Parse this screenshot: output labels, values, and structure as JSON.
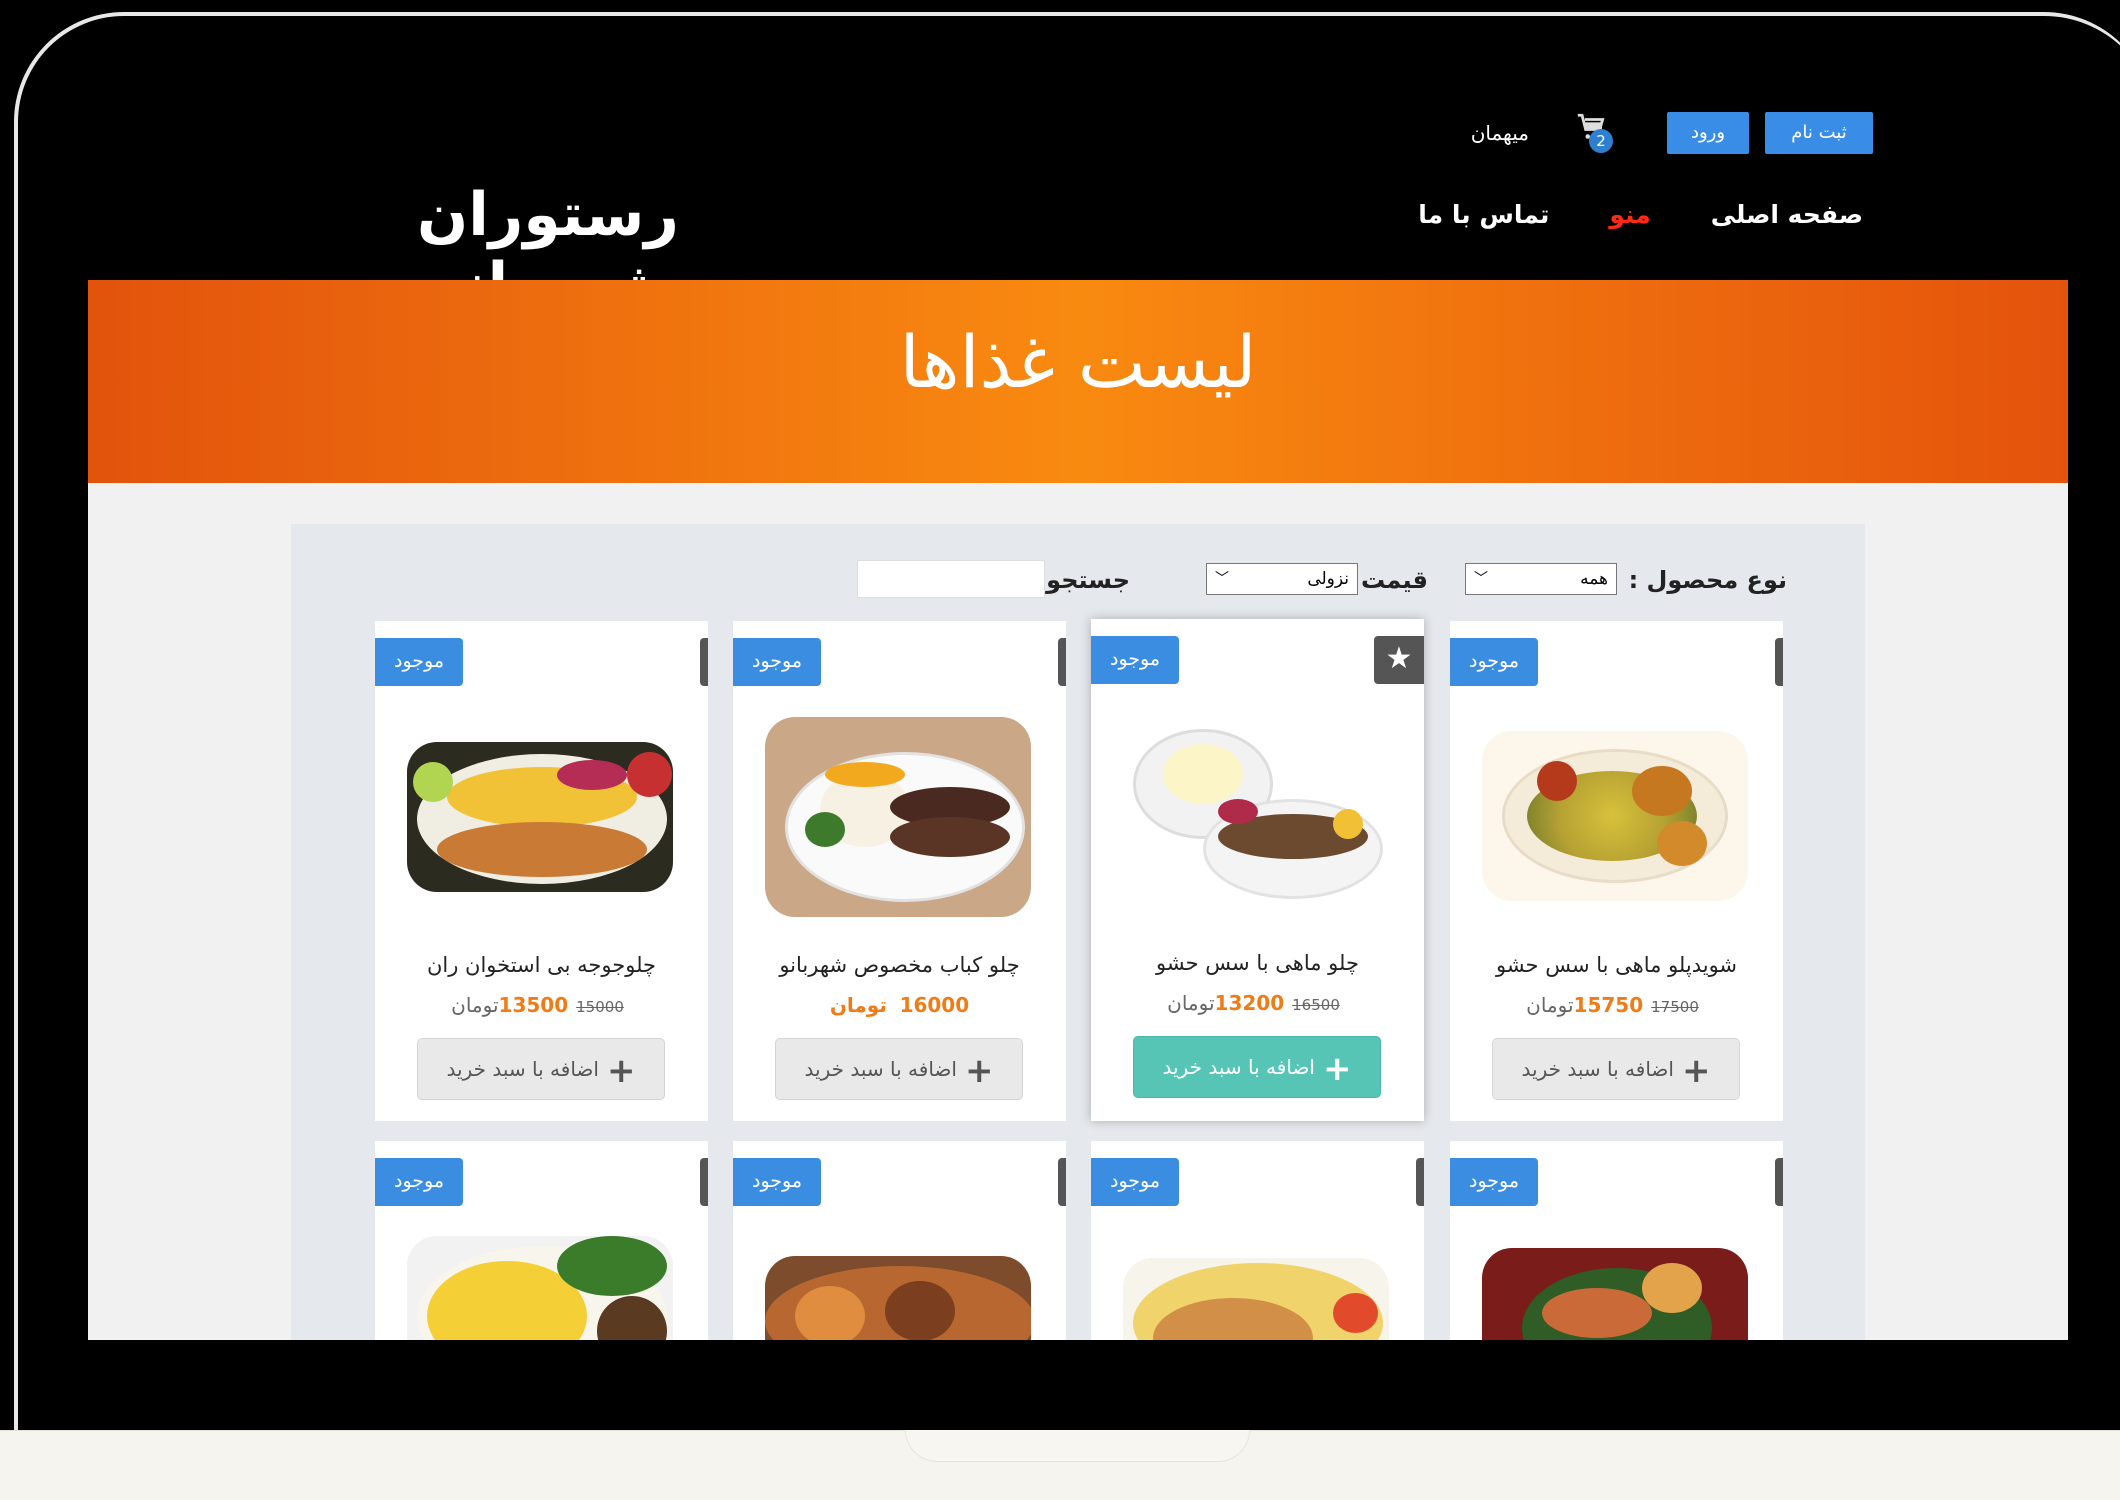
{
  "header": {
    "logo": "رستوران شهربانو",
    "guest_label": "میهمان",
    "cart_count": "2",
    "login_label": "ورود",
    "register_label": "ثبت نام",
    "nav": [
      {
        "label": "صفحه اصلی"
      },
      {
        "label": "منو"
      },
      {
        "label": "تماس با ما"
      }
    ]
  },
  "banner": {
    "title": "لیست غذاها"
  },
  "filters": {
    "type_label": "نوع محصول :",
    "type_value": "همه",
    "price_label": "قیمت :",
    "price_value": "نزولی",
    "search_label": "جستجو :",
    "search_value": ""
  },
  "products": [
    {
      "name": "شویدپلو ماهی با سس حشو",
      "price": "15750",
      "old_price": "17500",
      "currency": "تومان",
      "stock": "موجود",
      "button": "اضافه با سبد خرید"
    },
    {
      "name": "چلو ماهی با سس حشو",
      "price": "13200",
      "old_price": "16500",
      "currency": "تومان",
      "stock": "موجود",
      "button": "اضافه با سبد خرید"
    },
    {
      "name": "چلو کباب مخصوص شهربانو",
      "price": "16000",
      "currency": "تومان",
      "stock": "موجود",
      "button": "اضافه با سبد خرید"
    },
    {
      "name": "چلوجوجه بی استخوان ران",
      "price": "13500",
      "old_price": "15000",
      "currency": "تومان",
      "stock": "موجود",
      "button": "اضافه با سبد خرید"
    }
  ],
  "products_row2": [
    {
      "stock": "موجود"
    },
    {
      "stock": "موجود"
    },
    {
      "stock": "موجود"
    },
    {
      "stock": "موجود"
    }
  ],
  "colors": {
    "accent_orange": "#f98a10",
    "nav_active": "#ff2a12",
    "button_blue": "#3a8de6",
    "add_button_active": "#57c5b6"
  }
}
